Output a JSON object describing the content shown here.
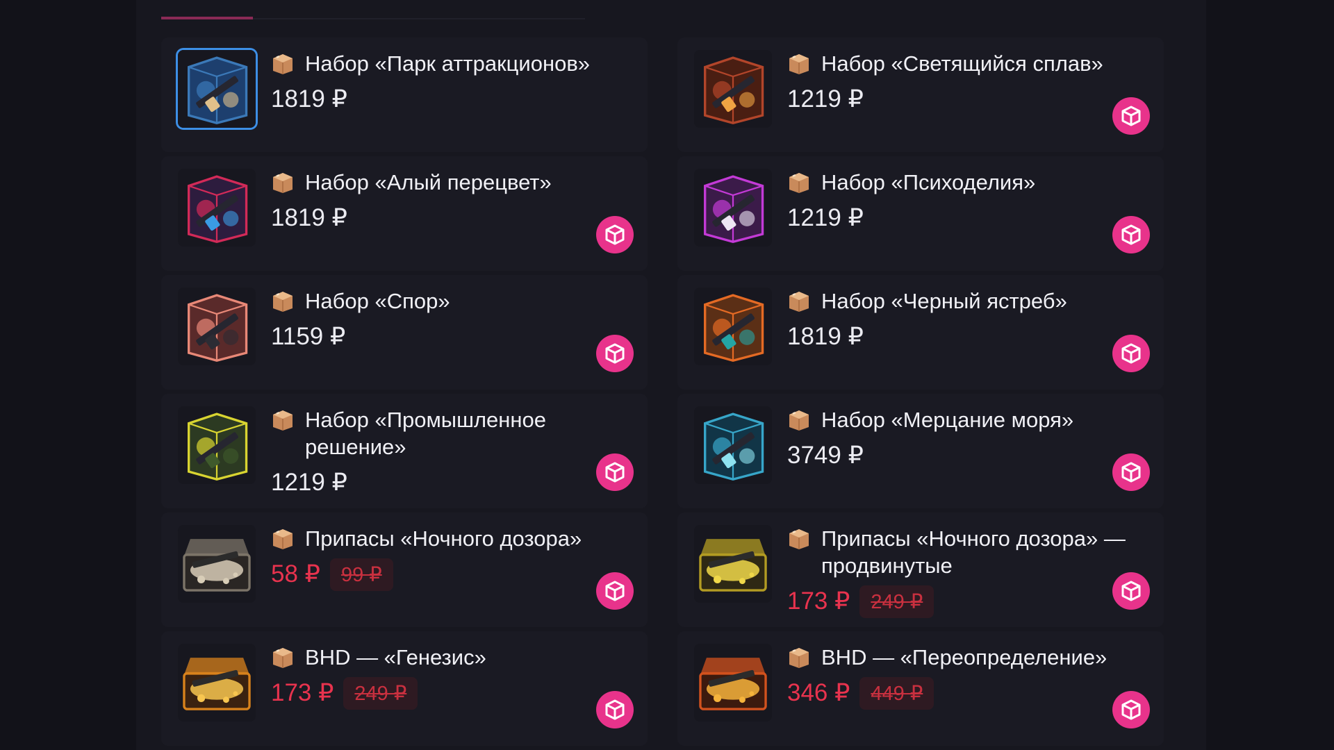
{
  "currency": "₽",
  "colors": {
    "background": "#121219",
    "panel": "#17171f",
    "card": "#1a1a23",
    "accent": "#e8338b",
    "sale": "#e8334e",
    "selection": "#3d8fe6"
  },
  "tabs": {
    "active_index": 0
  },
  "items": [
    {
      "title": "Набор «Парк аттракционов»",
      "price": "1819 ₽",
      "old_price": null,
      "selected": true,
      "has_cart": false,
      "thumb_theme": "blue"
    },
    {
      "title": "Набор «Светящийся сплав»",
      "price": "1219 ₽",
      "old_price": null,
      "selected": false,
      "has_cart": true,
      "thumb_theme": "rust"
    },
    {
      "title": "Набор «Алый перецвет»",
      "price": "1819 ₽",
      "old_price": null,
      "selected": false,
      "has_cart": true,
      "thumb_theme": "scarlet"
    },
    {
      "title": "Набор «Психоделия»",
      "price": "1219 ₽",
      "old_price": null,
      "selected": false,
      "has_cart": true,
      "thumb_theme": "psy"
    },
    {
      "title": "Набор «Спор»",
      "price": "1159 ₽",
      "old_price": null,
      "selected": false,
      "has_cart": true,
      "thumb_theme": "spore"
    },
    {
      "title": "Набор «Черный ястреб»",
      "price": "1819 ₽",
      "old_price": null,
      "selected": false,
      "has_cart": true,
      "thumb_theme": "hawk"
    },
    {
      "title": "Набор «Промышленное решение»",
      "price": "1219 ₽",
      "old_price": null,
      "selected": false,
      "has_cart": true,
      "thumb_theme": "industrial"
    },
    {
      "title": "Набор «Мерцание моря»",
      "price": "3749 ₽",
      "old_price": null,
      "selected": false,
      "has_cart": true,
      "thumb_theme": "sea"
    },
    {
      "title": "Припасы «Ночного дозора»",
      "price": "58 ₽",
      "old_price": "99 ₽",
      "selected": false,
      "has_cart": true,
      "thumb_theme": "chest-silver"
    },
    {
      "title": "Припасы «Ночного дозора» — продвинутые",
      "price": "173 ₽",
      "old_price": "249 ₽",
      "selected": false,
      "has_cart": true,
      "thumb_theme": "chest-gold"
    },
    {
      "title": "BHD — «Генезис»",
      "price": "173 ₽",
      "old_price": "249 ₽",
      "selected": false,
      "has_cart": true,
      "thumb_theme": "chest-orange"
    },
    {
      "title": "BHD — «Переопределение»",
      "price": "346 ₽",
      "old_price": "449 ₽",
      "selected": false,
      "has_cart": true,
      "thumb_theme": "chest-red"
    }
  ]
}
